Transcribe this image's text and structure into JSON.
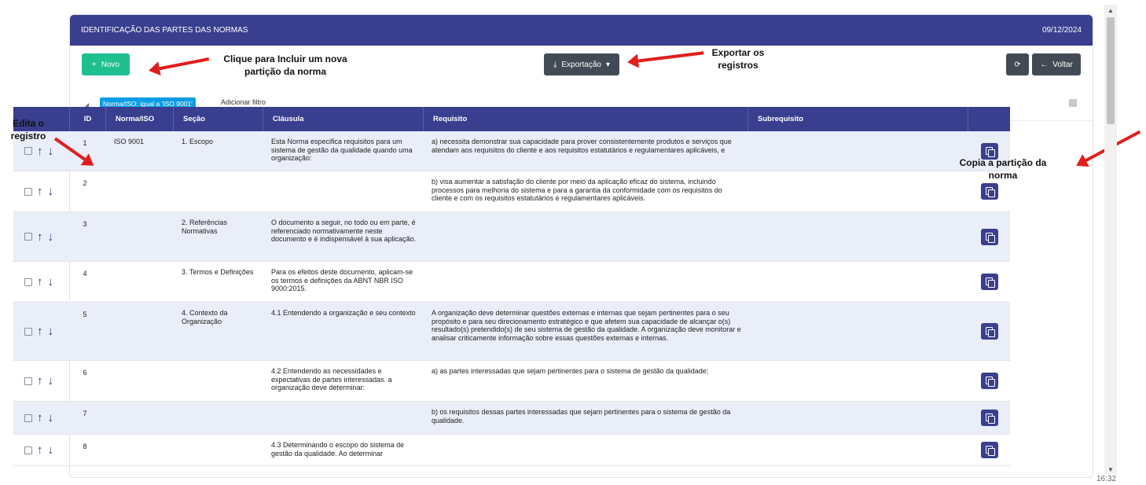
{
  "header": {
    "title": "IDENTIFICAÇÃO DAS PARTES DAS NORMAS",
    "date": "09/12/2024"
  },
  "toolbar": {
    "novo_label": "Novo",
    "export_label": "Exportação",
    "voltar_label": "Voltar"
  },
  "filter": {
    "chip_label": "Norma/ISO: igual a 'ISO 9001'",
    "add_label": "Adicionar filtro"
  },
  "table": {
    "headers": [
      "",
      "ID",
      "Norma/ISO",
      "Seção",
      "Cláusula",
      "Requisito",
      "Subrequisito",
      ""
    ],
    "rows": [
      {
        "id": "1",
        "norma": "ISO 9001",
        "secao": "1. Escopo",
        "clausula": "Esta Norma especifica requisitos para um sistema de gestão da qualidade quando uma organização:",
        "requisito": "a) necessita demonstrar sua capacidade para prover consistentemente produtos e serviços que atendam aos requisitos do cliente e aos requisitos estatutários e regulamentares aplicáveis, e",
        "subrequisito": ""
      },
      {
        "id": "2",
        "norma": "",
        "secao": "",
        "clausula": "",
        "requisito": "b) visa aumentar a satisfação do cliente por meio da aplicação eficaz do sistema, incluindo processos para melhoria do sistema e para a garantia da conformidade com os requisitos do cliente e com os requisitos estatutários e regulamentares aplicáveis.",
        "subrequisito": ""
      },
      {
        "id": "3",
        "norma": "",
        "secao": "2. Referências Normativas",
        "clausula": "O documento a seguir, no todo ou em parte, é referenciado normativamente neste documento e é indispensável à sua aplicação.",
        "requisito": "",
        "subrequisito": ""
      },
      {
        "id": "4",
        "norma": "",
        "secao": "3. Termos e Definições",
        "clausula": "Para os efeitos deste documento, aplicam-se os termos e definições da ABNT NBR ISO 9000:2015.",
        "requisito": "",
        "subrequisito": ""
      },
      {
        "id": "5",
        "norma": "",
        "secao": "4. Contexto da Organização",
        "clausula": "4.1 Entendendo a organização e seu contexto",
        "requisito": "A organização deve determinar questões externas e internas que sejam pertinentes para o seu propósito e para seu direcionamento estratégico e que afetem sua capacidade de alcançar o(s) resultado(s) pretendido(s) de seu sistema de gestão da qualidade. A organização deve monitorar e analisar criticamente informação sobre essas questões externas e internas.",
        "subrequisito": ""
      },
      {
        "id": "6",
        "norma": "",
        "secao": "",
        "clausula": "4.2 Entendendo as necessidades e expectativas de partes interessadas. a organização deve determinar:",
        "requisito": "a) as partes interessadas que sejam pertinentes para o sistema de gestão da qualidade;",
        "subrequisito": ""
      },
      {
        "id": "7",
        "norma": "",
        "secao": "",
        "clausula": "",
        "requisito": "b) os requisitos dessas partes interessadas que sejam pertinentes para o sistema de gestão da qualidade.",
        "subrequisito": ""
      },
      {
        "id": "8",
        "norma": "",
        "secao": "",
        "clausula": "4.3 Determinando o escopo do sistema de gestão da qualidade. Ao determinar",
        "requisito": "",
        "subrequisito": ""
      }
    ]
  },
  "annotations": {
    "novo": "Clique para Incluir um nova partição da norma",
    "export": "Exportar os registros",
    "edit": "Edita o registro",
    "copy": "Copia a partição da norma"
  },
  "clock": "16:32",
  "colors": {
    "header": "#393e8f",
    "novo": "#1fbf8f",
    "dark_button": "#424b55",
    "chip": "#0b9de3",
    "arrow": "#e01e1e"
  }
}
